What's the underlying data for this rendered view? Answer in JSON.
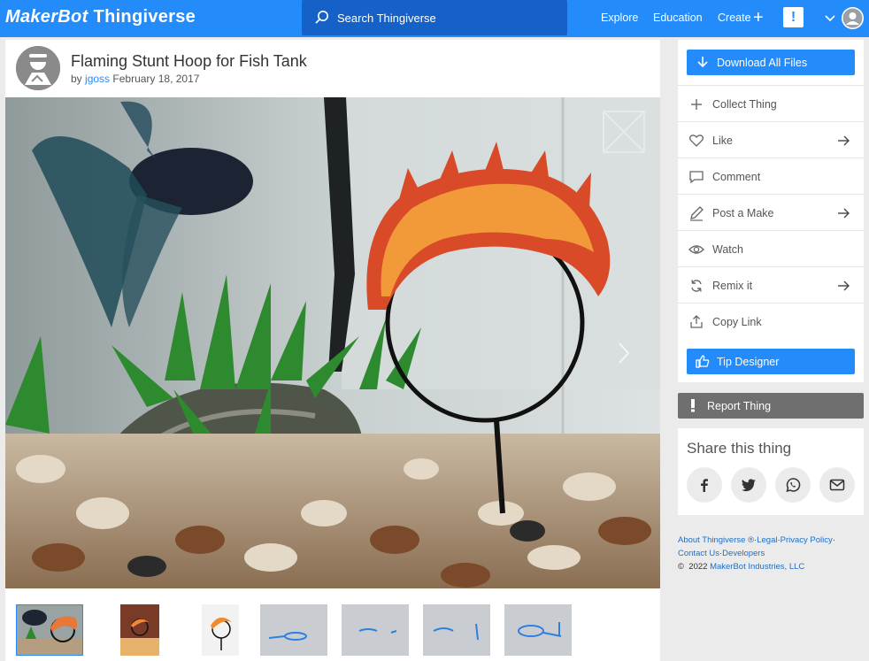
{
  "colors": {
    "accent": "#248bfb",
    "search_bg": "#1661c8",
    "report": "#6f6f6f",
    "page_bg": "#ebebeb"
  },
  "header": {
    "logo_makerbot": "MakerBot",
    "logo_thingiverse": "Thingiverse",
    "search_placeholder": "Search Thingiverse",
    "nav": {
      "explore": "Explore",
      "education": "Education",
      "create": "Create"
    },
    "alert_glyph": "!"
  },
  "thing": {
    "title": "Flaming Stunt Hoop for Fish Tank",
    "by": "by",
    "author": "jgoss",
    "date": "February 18, 2017"
  },
  "thumbnails_count": 7,
  "sidebar": {
    "download": "Download All Files",
    "actions": [
      {
        "label": "Collect Thing",
        "icon": "plus-icon",
        "arrow": false
      },
      {
        "label": "Like",
        "icon": "heart-icon",
        "arrow": true
      },
      {
        "label": "Comment",
        "icon": "comment-icon",
        "arrow": false
      },
      {
        "label": "Post a Make",
        "icon": "pencil-icon",
        "arrow": true
      },
      {
        "label": "Watch",
        "icon": "eye-icon",
        "arrow": false
      },
      {
        "label": "Remix it",
        "icon": "remix-icon",
        "arrow": true
      },
      {
        "label": "Copy Link",
        "icon": "share-upload-icon",
        "arrow": false
      }
    ],
    "tip": "Tip Designer",
    "report": "Report Thing"
  },
  "share": {
    "title": "Share this thing",
    "networks": [
      "facebook-icon",
      "twitter-icon",
      "whatsapp-icon",
      "email-icon"
    ]
  },
  "footer": {
    "about": "About Thingiverse",
    "reg": "®",
    "legal": "Legal",
    "privacy": "Privacy Policy",
    "contact": "Contact Us",
    "developers": "Developers",
    "copyright_symbol": "©",
    "year": "2022",
    "company": "MakerBot Industries, LLC"
  }
}
